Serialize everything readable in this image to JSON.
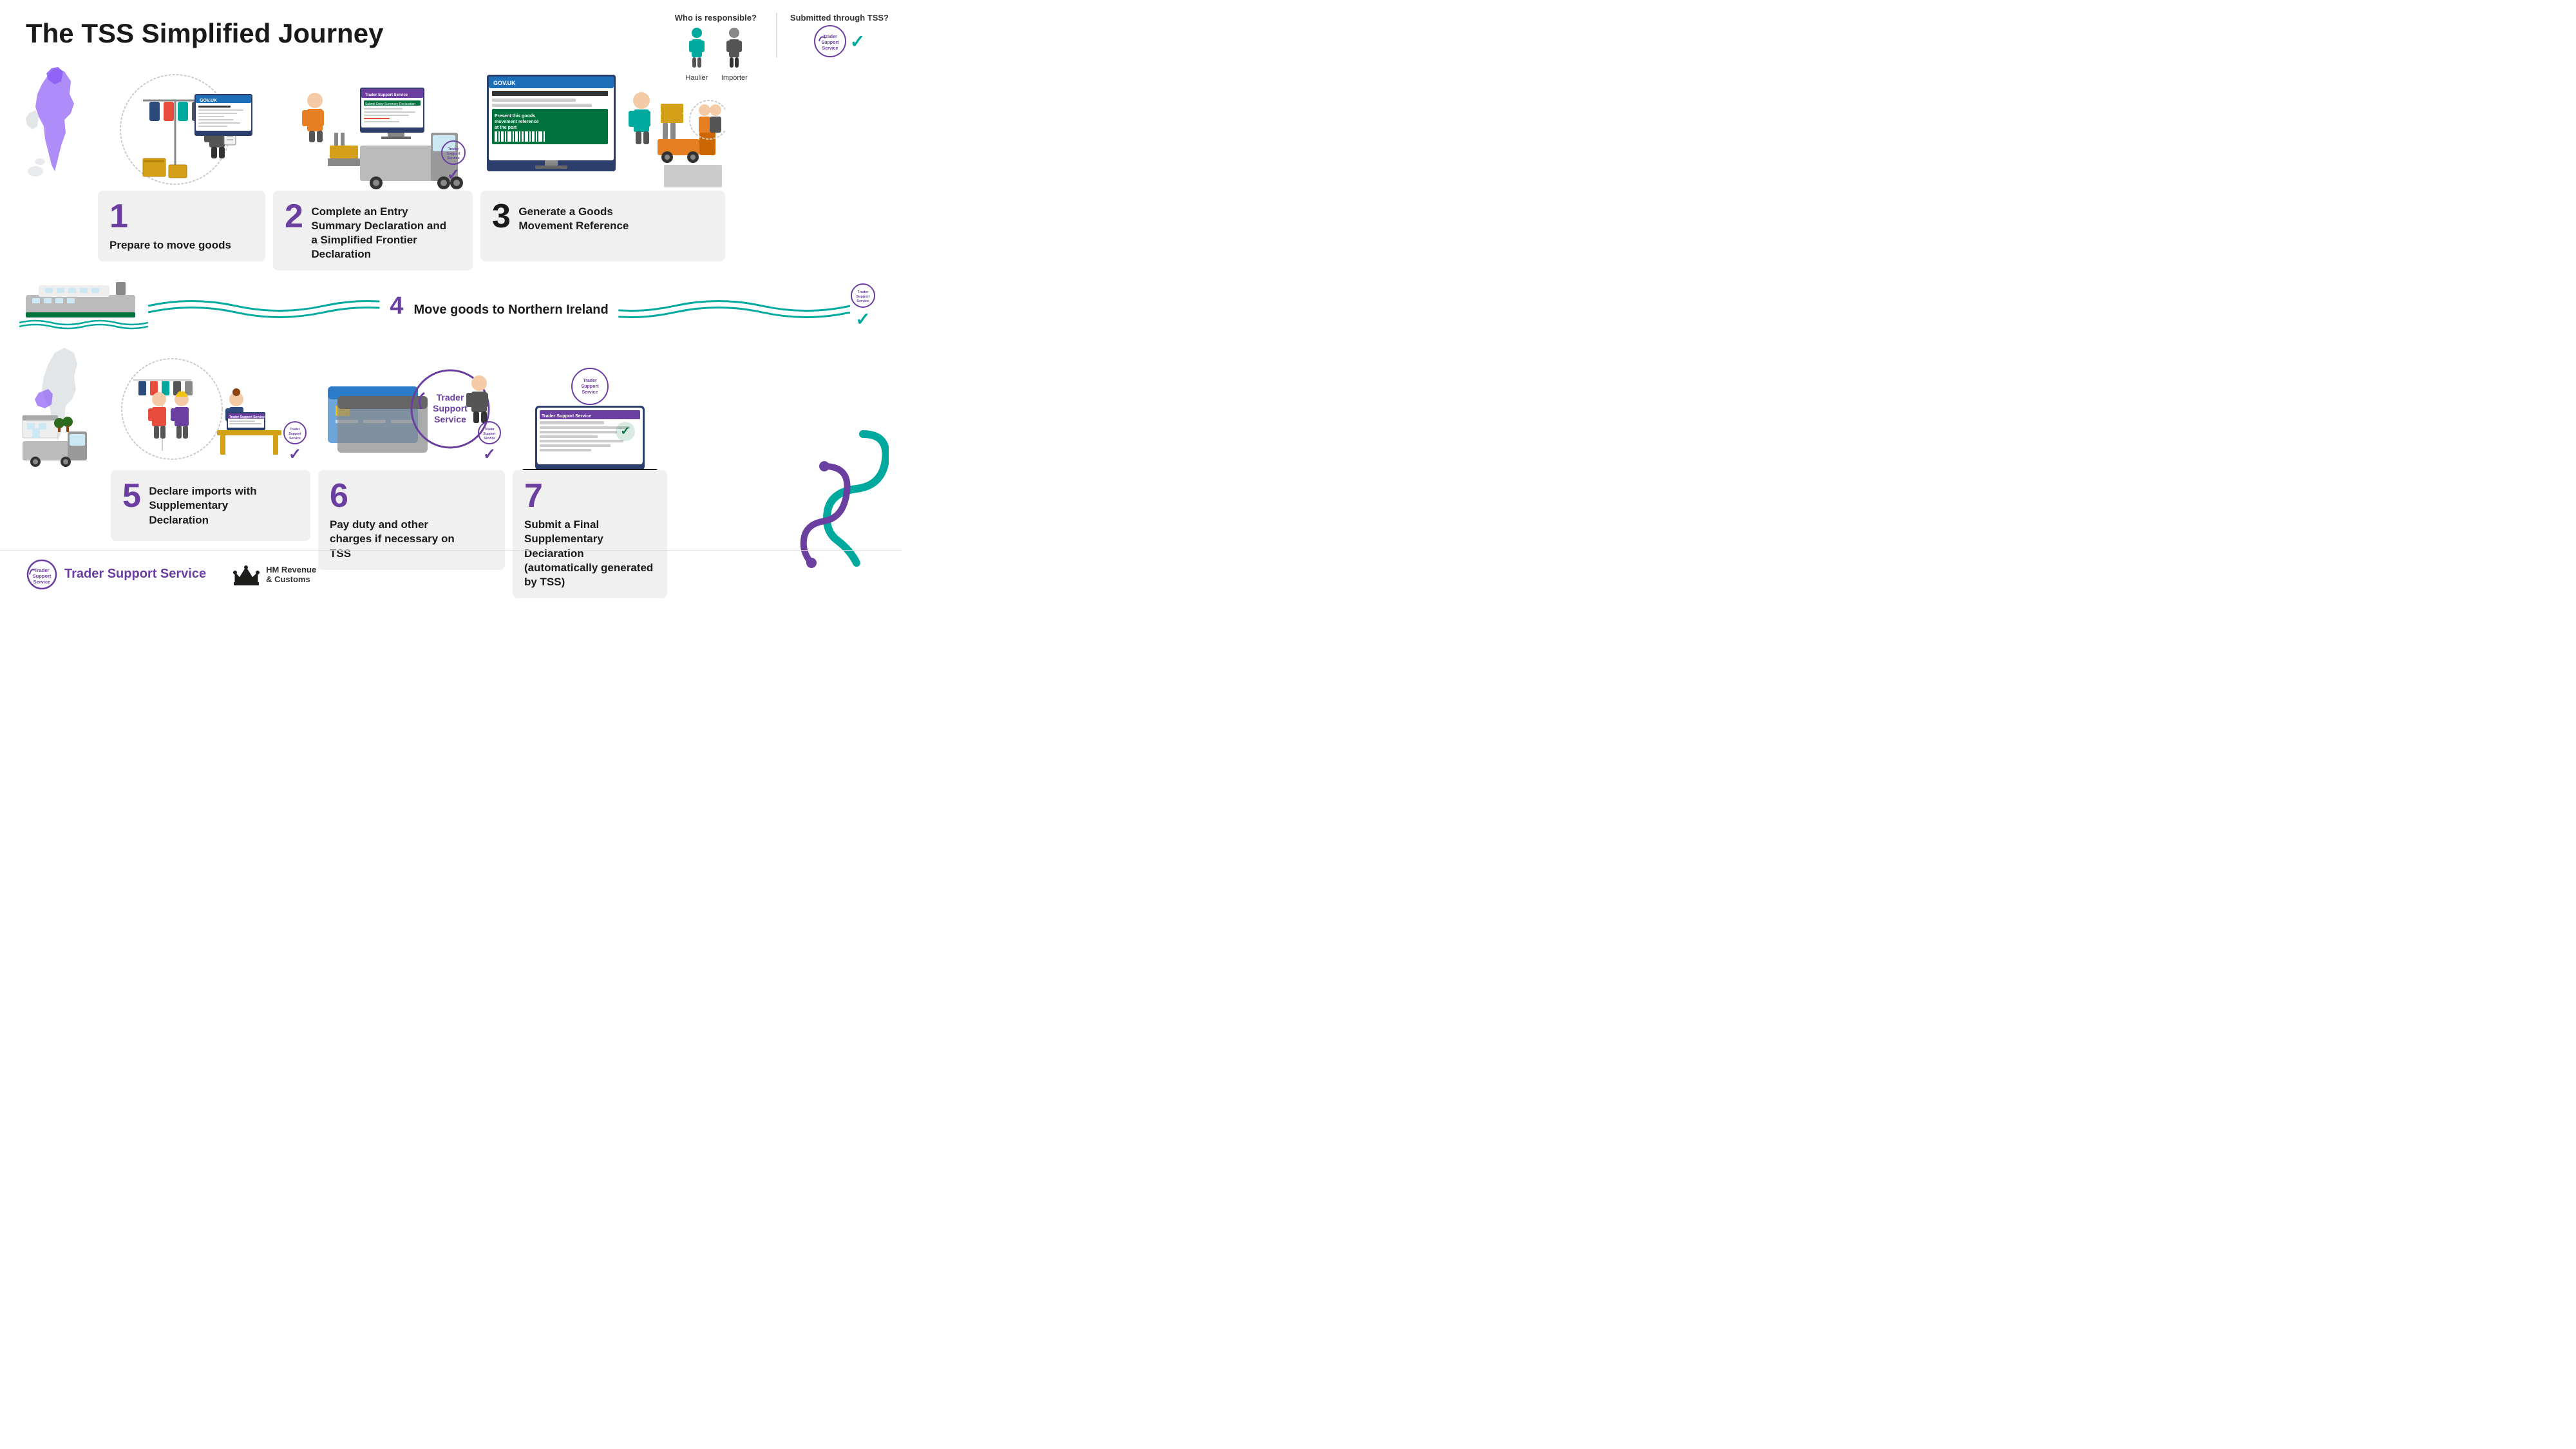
{
  "title": "The TSS Simplified Journey",
  "legend": {
    "who_label": "Who is responsible?",
    "submitted_label": "Submitted through TSS?",
    "haulier": "Haulier",
    "importer": "Importer"
  },
  "steps": {
    "step1": {
      "number": "1",
      "text": "Prepare to move goods"
    },
    "step2": {
      "number": "2",
      "text": "Complete an Entry Summary Declaration and a Simplified Frontier Declaration"
    },
    "step3": {
      "number": "3",
      "text": "Generate a Goods Movement Reference"
    },
    "step4": {
      "number": "4",
      "text": "Move goods to Northern Ireland"
    },
    "step5": {
      "number": "5",
      "text": "Declare imports with Supplementary Declaration"
    },
    "step6": {
      "number": "6",
      "text": "Pay duty and other charges if necessary on TSS"
    },
    "step7": {
      "number": "7",
      "text": "Submit a Final Supplementary Declaration (automatically generated by TSS)"
    }
  },
  "tss_logo": {
    "line1": "Trader",
    "line2": "Support",
    "line3": "Service"
  },
  "footer": {
    "tss_name": "Trader Support Service",
    "hmrc_line1": "HM Revenue",
    "hmrc_line2": "& Customs"
  }
}
